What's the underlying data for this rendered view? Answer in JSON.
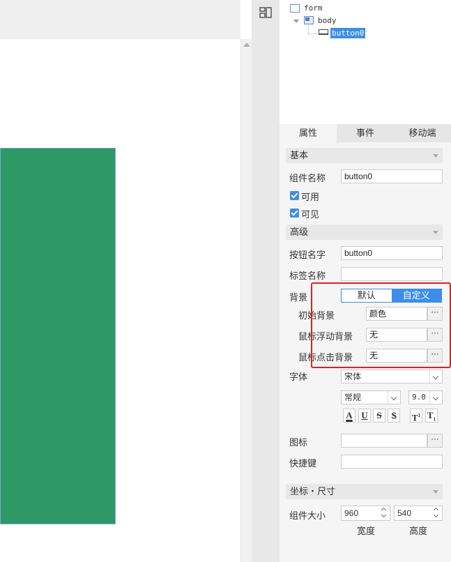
{
  "tree": {
    "form_label": "form",
    "body_label": "body",
    "button_label": "button0"
  },
  "tabs": [
    "属性",
    "事件",
    "移动端"
  ],
  "sections": {
    "basic": "基本",
    "advanced": "高级",
    "coord_size": "坐标・尺寸"
  },
  "basic": {
    "component_name_label": "组件名称",
    "component_name_value": "button0",
    "enabled_label": "可用",
    "visible_label": "可见"
  },
  "advanced": {
    "button_text_label": "按钮名字",
    "button_text_value": "button0",
    "tag_name_label": "标签名称",
    "tag_name_value": "",
    "background_label": "背景",
    "bg_toggle": [
      "默认",
      "自定义"
    ],
    "initial_bg_label": "初始背景",
    "initial_bg_value": "颜色",
    "hover_bg_label": "鼠标浮动背景",
    "hover_bg_value": "无",
    "click_bg_label": "鼠标点击背景",
    "click_bg_value": "无",
    "more": "···",
    "font_label": "字体",
    "font_family": "宋体",
    "font_style": "常规",
    "font_size": "9.0",
    "icon_label": "图标",
    "shortcut_label": "快捷键",
    "format_buttons": [
      "A",
      "U",
      "S",
      "S",
      "T",
      "T"
    ]
  },
  "size": {
    "label": "组件大小",
    "width": "960",
    "height": "540",
    "width_label": "宽度",
    "height_label": "高度"
  },
  "colors": {
    "button_fill": "#2e9965",
    "accent": "#3d8ee8",
    "highlight_box": "#e02020"
  }
}
